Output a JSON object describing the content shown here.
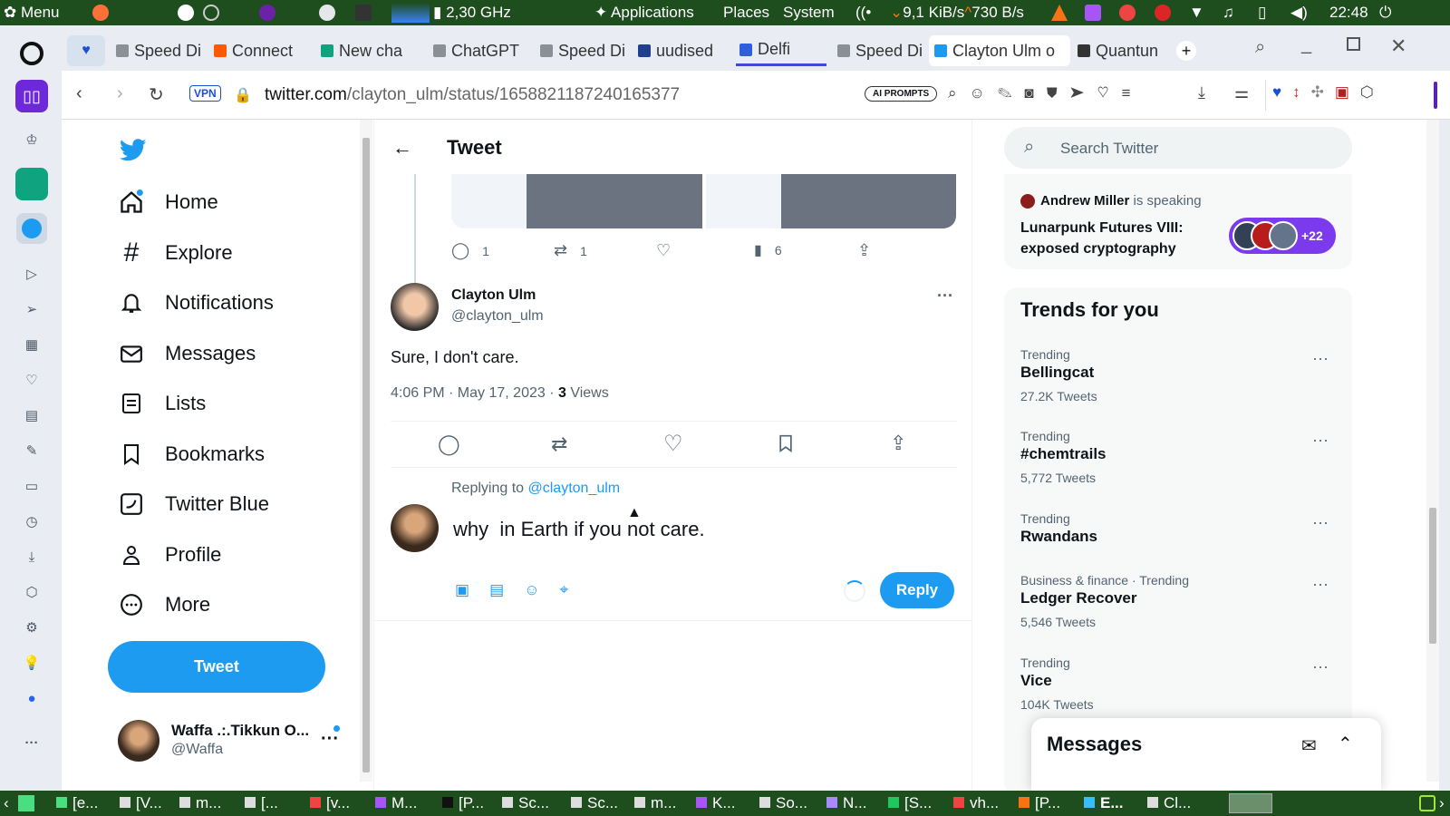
{
  "system_panel": {
    "menu_label": "Menu",
    "cpu_freq": "2,30 GHz",
    "applications": "Applications",
    "places": "Places",
    "system": "System",
    "net_down": "9,1 KiB/s",
    "net_up": "730 B/s",
    "clock": "22:48"
  },
  "tabs": [
    {
      "label": "Speed Di",
      "color": "#8a8f98"
    },
    {
      "label": "Connect",
      "color": "#ff5a00"
    },
    {
      "label": "New cha",
      "color": "#10a37f"
    },
    {
      "label": "ChatGPT",
      "color": "#8a8f98"
    },
    {
      "label": "Speed Di",
      "color": "#8a8f98"
    },
    {
      "label": "uudised",
      "color": "#1f3f8f"
    },
    {
      "label": "Delfi",
      "color": "#2f5fdc"
    },
    {
      "label": "Speed Di",
      "color": "#8a8f98"
    },
    {
      "label": "Clayton Ulm o",
      "color": "#1d9bf0"
    },
    {
      "label": "Quantun",
      "color": "#333333"
    }
  ],
  "address": {
    "vpn": "VPN",
    "host": "twitter.com",
    "path": "/clayton_ulm/status/1658821187240165377",
    "ai_prompts": "AI PROMPTS"
  },
  "nav": {
    "home": "Home",
    "explore": "Explore",
    "notifications": "Notifications",
    "messages": "Messages",
    "lists": "Lists",
    "bookmarks": "Bookmarks",
    "twitter_blue": "Twitter Blue",
    "profile": "Profile",
    "more": "More",
    "tweet_button": "Tweet"
  },
  "account": {
    "name": "Waffa .:.Tikkun O...",
    "handle": "@Waffa"
  },
  "header": {
    "title": "Tweet"
  },
  "parent_tweet": {
    "replies": "1",
    "retweets": "1",
    "views": "6"
  },
  "tweet": {
    "author": "Clayton Ulm",
    "handle": "@clayton_ulm",
    "text": "Sure, I don't care.",
    "timestamp": "4:06 PM · May 17, 2023 · ",
    "views_count": "3",
    "views_label": " Views"
  },
  "reply": {
    "replying_to_prefix": "Replying to ",
    "replying_to_handle": "@clayton_ulm",
    "draft_text": "why  in Earth if you not care.",
    "reply_button": "Reply"
  },
  "search": {
    "placeholder": "Search Twitter"
  },
  "space": {
    "host": "Andrew Miller",
    "status": " is speaking",
    "title": "Lunarpunk Futures VIII: exposed cryptography",
    "listener_count": "+22"
  },
  "trends": {
    "heading": "Trends for you",
    "items": [
      {
        "category": "Trending",
        "name": "Bellingcat",
        "count": "27.2K Tweets"
      },
      {
        "category": "Trending",
        "name": "#chemtrails",
        "count": "5,772 Tweets"
      },
      {
        "category": "Trending",
        "name": "Rwandans",
        "count": ""
      },
      {
        "category": "Business & finance · Trending",
        "name": "Ledger Recover",
        "count": "5,546 Tweets"
      },
      {
        "category": "Trending",
        "name": "Vice",
        "count": "104K Tweets"
      }
    ]
  },
  "messages_drawer": {
    "title": "Messages"
  },
  "taskbar": {
    "items": [
      "[e...",
      "[V...",
      "m...",
      "[...",
      "[v...",
      "M...",
      "[P...",
      "Sc...",
      "Sc...",
      "m...",
      "K...",
      "So...",
      "N...",
      "[S...",
      "vh...",
      "[P...",
      "E...",
      "Cl..."
    ]
  },
  "colors": {
    "twitter_blue": "#1d9bf0",
    "panel_green": "#1e4d1e"
  }
}
